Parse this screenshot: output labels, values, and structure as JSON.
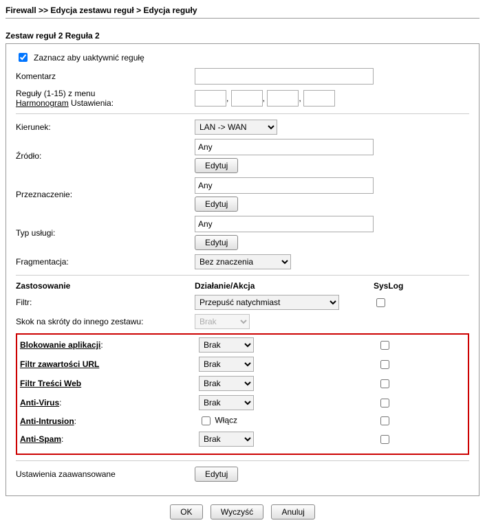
{
  "breadcrumb": {
    "part1": "Firewall",
    "sep1": " >> ",
    "part2": "Edycja zestawu reguł",
    "sep2": " > ",
    "part3": "Edycja reguły"
  },
  "section_title": "Zestaw reguł 2 Reguła 2",
  "activate": {
    "label": "Zaznacz aby uaktywnić regułę",
    "checked": true
  },
  "comment": {
    "label": "Komentarz",
    "value": ""
  },
  "schedule": {
    "label_rules": "Reguły (1-15) z menu ",
    "label_link": "Harmonogram",
    "label_settings": " Ustawienia:",
    "values": [
      "",
      "",
      "",
      ""
    ]
  },
  "direction": {
    "label": "Kierunek:",
    "selected": "LAN -> WAN"
  },
  "source": {
    "label": "Źródło:",
    "value": "Any",
    "edit": "Edytuj"
  },
  "destination": {
    "label": "Przeznaczenie:",
    "value": "Any",
    "edit": "Edytuj"
  },
  "service_type": {
    "label": "Typ usługi:",
    "value": "Any",
    "edit": "Edytuj"
  },
  "fragmentation": {
    "label": "Fragmentacja:",
    "selected": "Bez znaczenia"
  },
  "headers": {
    "application": "Zastosowanie",
    "action": "Działanie/Akcja",
    "syslog": "SysLog"
  },
  "filter": {
    "label": "Filtr:",
    "selected": "Przepuść natychmiast",
    "syslog": false
  },
  "shortcut": {
    "label": "Skok na skróty do innego zestawu:",
    "selected": "Brak"
  },
  "app_block": {
    "label": "Blokowanie aplikacji",
    "colon": ":",
    "selected": "Brak",
    "syslog": false
  },
  "url_filter": {
    "label": "Filtr zawartości URL",
    "selected": "Brak",
    "syslog": false
  },
  "web_filter": {
    "label": "Filtr Treści Web",
    "selected": "Brak",
    "syslog": false
  },
  "antivirus": {
    "label": "Anti-Virus",
    "colon": ":",
    "selected": "Brak",
    "syslog": false
  },
  "anti_intrusion": {
    "label": "Anti-Intrusion",
    "colon": ":",
    "enable_label": "Włącz",
    "enabled": false,
    "syslog": false
  },
  "anti_spam": {
    "label": "Anti-Spam",
    "colon": ":",
    "selected": "Brak",
    "syslog": false
  },
  "advanced": {
    "label": "Ustawienia zaawansowane",
    "edit": "Edytuj"
  },
  "buttons": {
    "ok": "OK",
    "clear": "Wyczyść",
    "cancel": "Anuluj"
  }
}
